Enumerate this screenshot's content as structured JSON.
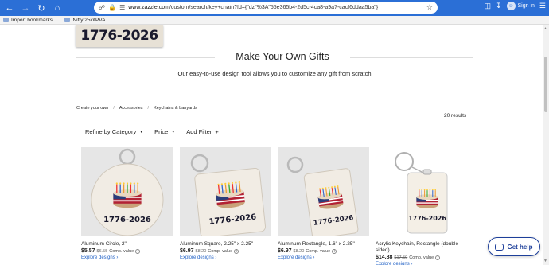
{
  "browser": {
    "url_prefix": "www.zazzle.com",
    "url_rest": "/custom/search/key+chain?fd={\"dz\"%3A\"55e365b4-2d5c-4ca8-a9a7-cacf6ddaa5ba\"}",
    "sign_in": "Sign in",
    "bookmarks": [
      "Import bookmarks...",
      "Nifty 25kitPVA"
    ]
  },
  "hero": {
    "image_text": "1776-2026"
  },
  "section": {
    "title": "Make Your Own Gifts",
    "subtitle": "Our easy-to-use design tool allows you to customize any gift from scratch"
  },
  "breadcrumb": [
    "Create your own",
    "Accessories",
    "Keychains & Lanyards"
  ],
  "results": "20 results",
  "filters": {
    "category": "Refine by Category",
    "price": "Price",
    "add": "Add Filter",
    "add_icon": "+"
  },
  "products": [
    {
      "name": "Aluminum Circle, 2\"",
      "price": "$5.57",
      "orig": "$6.55",
      "comp": "Comp. value",
      "explore": "Explore designs",
      "shape": "circle",
      "label": "1776-2026"
    },
    {
      "name": "Aluminum Square, 2.25\" x 2.25\"",
      "price": "$6.97",
      "orig": "$8.20",
      "comp": "Comp. value",
      "explore": "Explore designs",
      "shape": "square",
      "label": "1776-2026"
    },
    {
      "name": "Aluminum Rectangle, 1.6\" x 2.25\"",
      "price": "$6.97",
      "orig": "$8.20",
      "comp": "Comp. value",
      "explore": "Explore designs",
      "shape": "rect",
      "label": "1776-2026"
    },
    {
      "name": "Acrylic Keychain, Rectangle (double-sided)",
      "price": "$14.88",
      "orig": "$17.50",
      "comp": "Comp. value",
      "explore": "Explore designs",
      "shape": "acrylic",
      "label": "1776-2026"
    }
  ],
  "help": "Get help"
}
